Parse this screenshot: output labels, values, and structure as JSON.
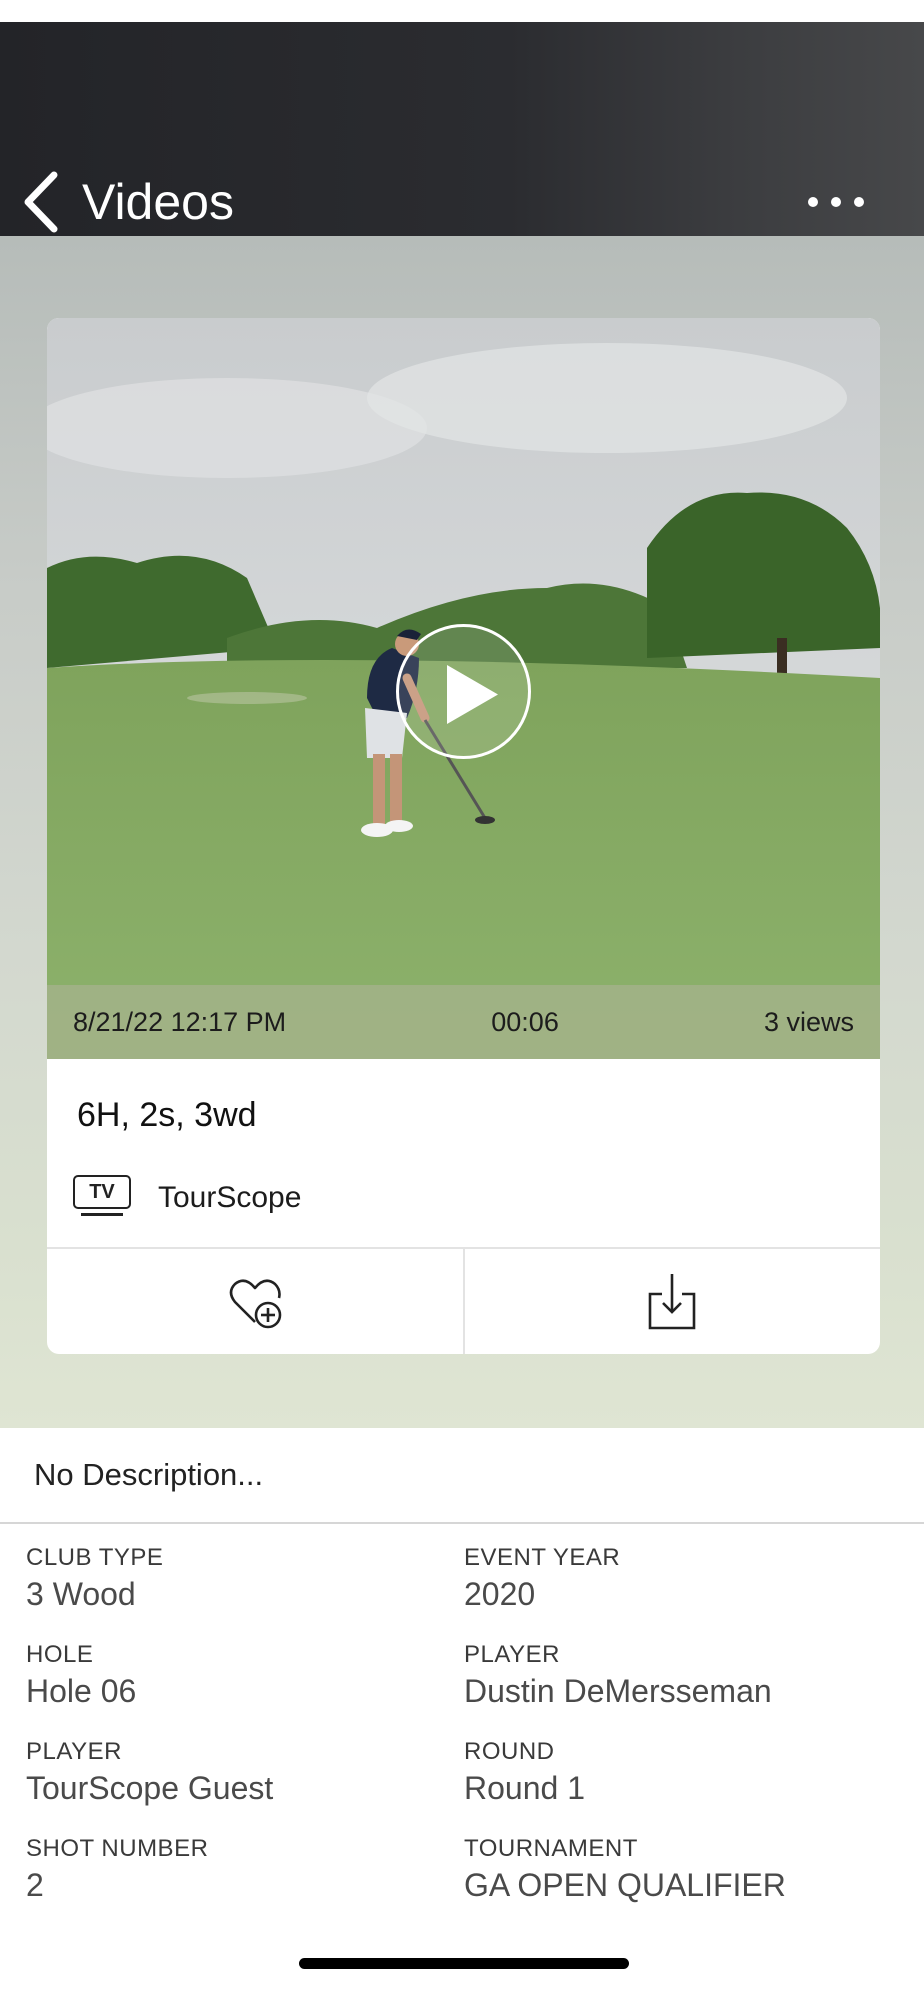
{
  "header": {
    "back_label": "Videos",
    "back_icon": "chevron-left-icon",
    "more_icon": "ellipsis-icon"
  },
  "video": {
    "date": "8/21/22 12:17 PM",
    "duration": "00:06",
    "views": "3 views",
    "play_icon": "play-icon",
    "title": "6H, 2s, 3wd",
    "channel_badge": "TV",
    "channel_name": "TourScope"
  },
  "actions": {
    "favorite_icon": "heart-plus-icon",
    "download_icon": "download-icon"
  },
  "description": "No Description...",
  "details": {
    "left": [
      {
        "label": "CLUB TYPE",
        "value": "3 Wood"
      },
      {
        "label": "HOLE",
        "value": "Hole 06"
      },
      {
        "label": "PLAYER",
        "value": "TourScope Guest"
      },
      {
        "label": "SHOT NUMBER",
        "value": "2"
      }
    ],
    "right": [
      {
        "label": "EVENT YEAR",
        "value": "2020"
      },
      {
        "label": "PLAYER",
        "value": "Dustin DeMersseman"
      },
      {
        "label": "ROUND",
        "value": "Round 1"
      },
      {
        "label": "TOURNAMENT",
        "value": "GA OPEN QUALIFIER"
      }
    ]
  },
  "colors": {
    "header_bg": "#2b2c30",
    "meta_bar": "#a5b28c",
    "fairway": "#8fb06a",
    "text_secondary": "#4a4a4a"
  }
}
